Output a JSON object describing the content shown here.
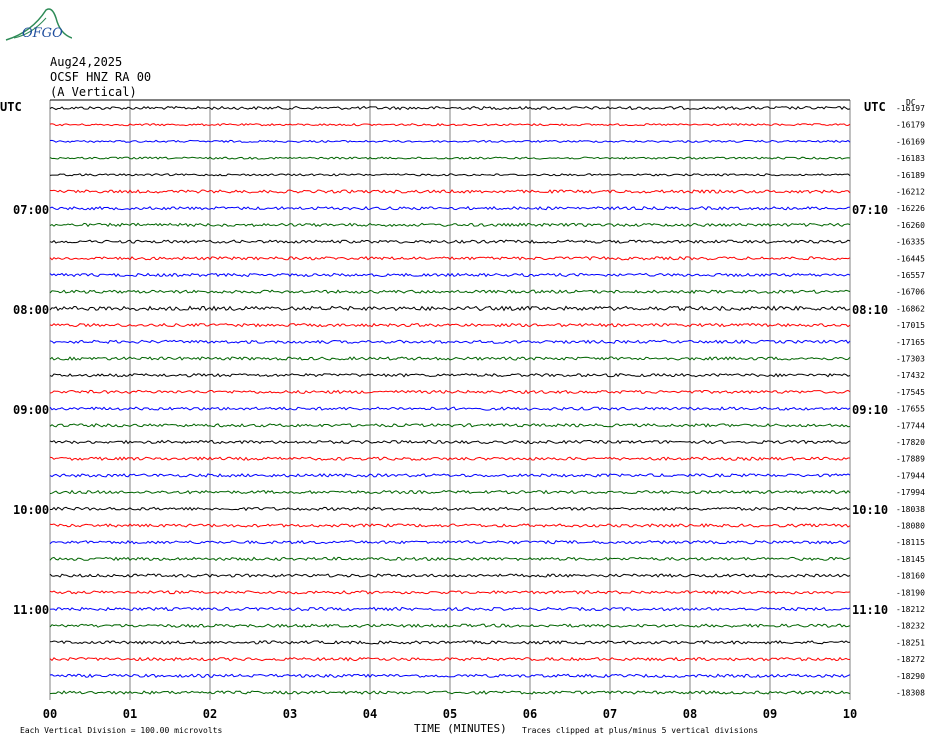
{
  "logo": {
    "text": "OFGO"
  },
  "header": {
    "date": "Aug24,2025",
    "station": "OCSF HNZ RA 00",
    "component": "(A Vertical)"
  },
  "left_axis": {
    "title": "UTC",
    "labels": [
      "07:00",
      "08:00",
      "09:00",
      "10:00",
      "11:00"
    ]
  },
  "right_axis": {
    "title": "UTC",
    "labels": [
      "07:10",
      "08:10",
      "09:10",
      "10:10",
      "11:10"
    ]
  },
  "right_top_tag": "DC",
  "footer": {
    "scale_note": "Each Vertical Division =  100.00 microvolts",
    "xlabel": "TIME (MINUTES)",
    "clip_note": "Traces clipped at plus/minus 5 vertical divisions"
  },
  "colors": {
    "black": "#000000",
    "red": "#ff0000",
    "blue": "#0000ff",
    "green": "#006400",
    "grid": "#808080"
  },
  "chart_data": {
    "type": "line",
    "title": "OCSF HNZ RA 00 (A Vertical)",
    "xlabel": "TIME (MINUTES)",
    "xlim": [
      0,
      10
    ],
    "x_ticks": [
      "00",
      "01",
      "02",
      "03",
      "04",
      "05",
      "06",
      "07",
      "08",
      "09",
      "10"
    ],
    "trace_colors": [
      "black",
      "red",
      "blue",
      "green"
    ],
    "dc_offsets": [
      -16197,
      -16179,
      -16169,
      -16183,
      -16189,
      -16212,
      -16226,
      -16260,
      -16335,
      -16445,
      -16557,
      -16706,
      -16862,
      -17015,
      -17165,
      -17303,
      -17432,
      -17545,
      -17655,
      -17744,
      -17820,
      -17889,
      -17944,
      -17994,
      -18038,
      -18080,
      -18115,
      -18145,
      -18160,
      -18190,
      -18212,
      -18232,
      -18251,
      -18272,
      -18290,
      -18308
    ],
    "noise_level": [
      3,
      2,
      2,
      2,
      2,
      3,
      3,
      3,
      3,
      3,
      3,
      3,
      4,
      3,
      3,
      3,
      3,
      3,
      3,
      3,
      3,
      3,
      3,
      3,
      3,
      3,
      3,
      3,
      3,
      3,
      3,
      3,
      3,
      3,
      3,
      3
    ]
  }
}
